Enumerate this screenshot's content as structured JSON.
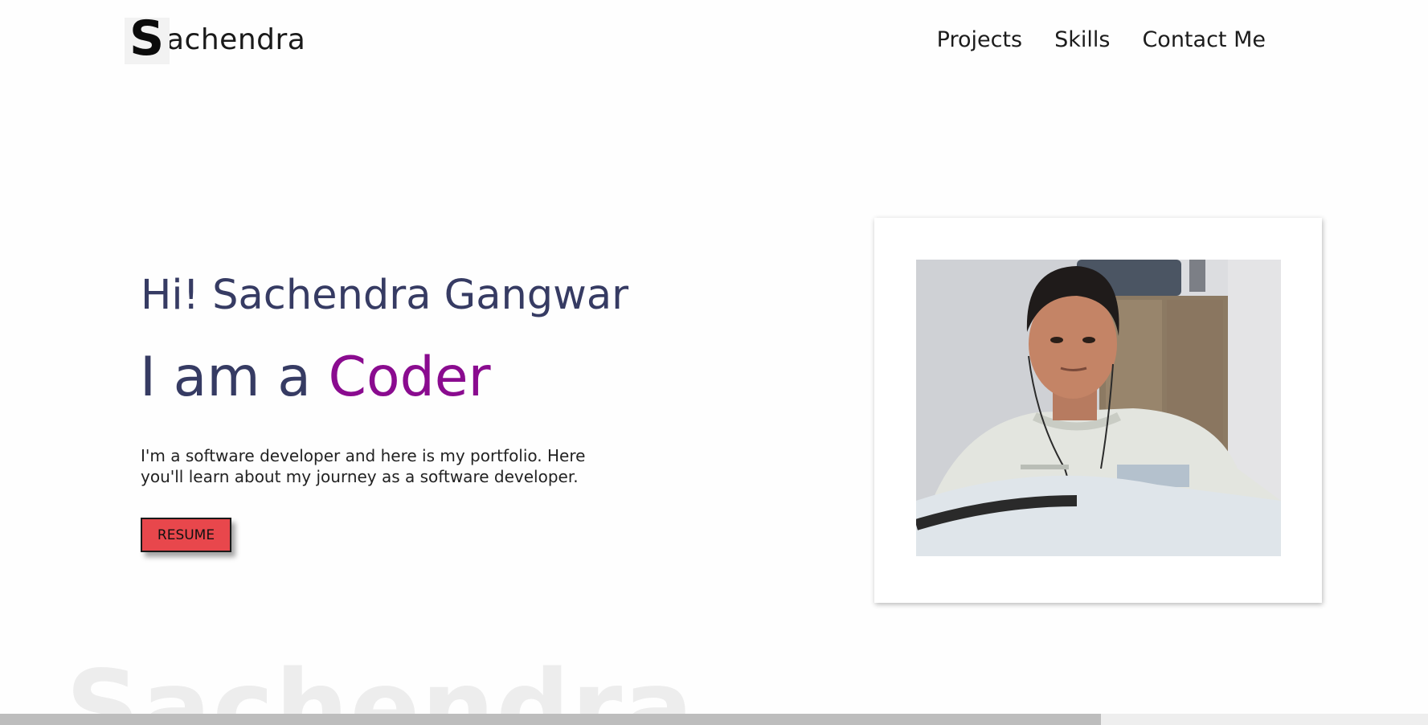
{
  "header": {
    "logo_initial": "S",
    "logo_rest": "achendra",
    "nav": {
      "projects": "Projects",
      "skills": "Skills",
      "contact": "Contact Me"
    }
  },
  "hero": {
    "greeting": "Hi! Sachendra Gangwar",
    "role_prefix": "I am a ",
    "role_word": "Coder",
    "description": "I'm a software developer and here is my portfolio. Here you'll learn about my journey as a software developer.",
    "resume_label": "RESUME",
    "photo_alt": "Sachendra Gangwar"
  },
  "footer": {
    "watermark": "Sachendra"
  },
  "scrollbar": {
    "position_fraction": 0.77
  },
  "colors": {
    "heading": "#363b63",
    "accent": "#8a0b8f",
    "button": "#e8474c"
  }
}
